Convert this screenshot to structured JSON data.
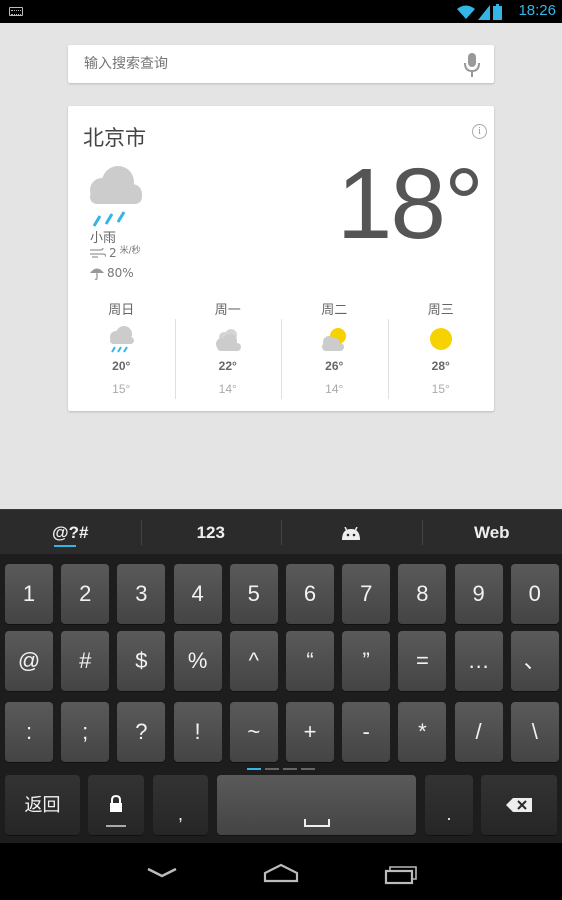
{
  "status_bar": {
    "time": "18:26",
    "icons": [
      "keyboard-icon",
      "wifi-icon",
      "signal-icon",
      "battery-icon"
    ],
    "accent": "#33b5e5"
  },
  "search": {
    "placeholder": "输入搜索查询",
    "mic_icon": "microphone-icon"
  },
  "weather": {
    "city": "北京市",
    "info_icon": "i",
    "temperature": "18°",
    "current_icon": "rain-cloud-icon",
    "condition": "小雨",
    "wind_value": "2",
    "wind_unit": "米/秒",
    "precipitation": "80%",
    "forecast": [
      {
        "day": "周日",
        "icon": "rain-cloud-icon",
        "high": "20°",
        "low": "15°"
      },
      {
        "day": "周一",
        "icon": "cloudy-icon",
        "high": "22°",
        "low": "14°"
      },
      {
        "day": "周二",
        "icon": "partly-sunny-icon",
        "high": "26°",
        "low": "14°"
      },
      {
        "day": "周三",
        "icon": "sun-icon",
        "high": "28°",
        "low": "15°"
      }
    ]
  },
  "keyboard": {
    "top_row": [
      "@?#",
      "123",
      "android-icon",
      "Web"
    ],
    "row1": [
      "1",
      "2",
      "3",
      "4",
      "5",
      "6",
      "7",
      "8",
      "9",
      "0"
    ],
    "row2": [
      "@",
      "#",
      "$",
      "%",
      "^",
      "“",
      "”",
      "=",
      "…",
      "、"
    ],
    "row3": [
      ":",
      ";",
      "?",
      "!",
      "~",
      "+",
      "-",
      "*",
      "/",
      "\\"
    ],
    "back_label": "返回",
    "lock_icon": "lock-icon",
    "comma": ",",
    "space_icon": "space-icon",
    "period": ".",
    "delete_icon": "backspace-icon"
  },
  "nav_bar": {
    "buttons": [
      "back-chevron-icon",
      "home-icon",
      "recent-apps-icon"
    ]
  }
}
